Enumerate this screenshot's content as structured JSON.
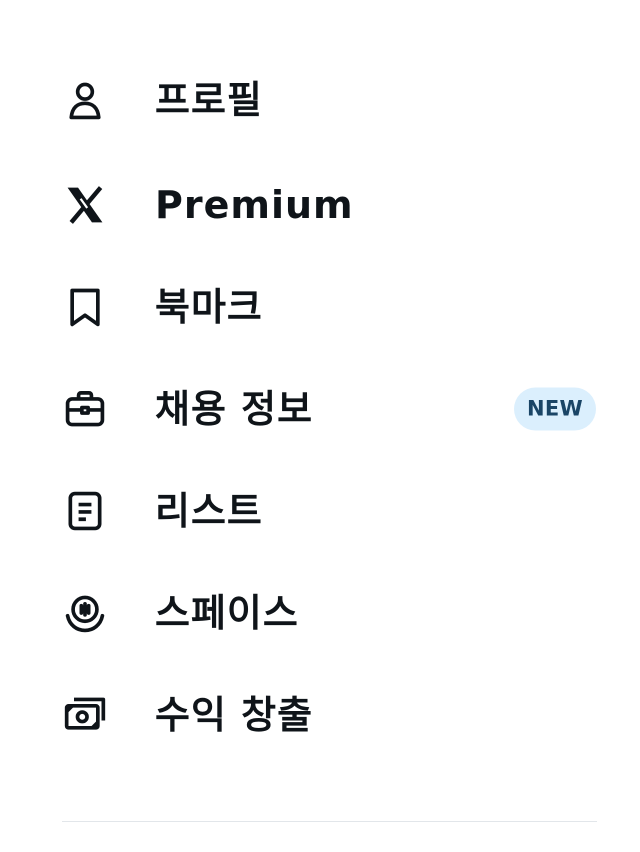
{
  "menu": {
    "items": [
      {
        "label": "프로필",
        "icon": "person-icon"
      },
      {
        "label": "Premium",
        "icon": "x-logo-icon"
      },
      {
        "label": "북마크",
        "icon": "bookmark-icon"
      },
      {
        "label": "채용 정보",
        "icon": "briefcase-icon",
        "badge": "NEW"
      },
      {
        "label": "리스트",
        "icon": "list-icon"
      },
      {
        "label": "스페이스",
        "icon": "spaces-icon"
      },
      {
        "label": "수익 창출",
        "icon": "money-icon"
      }
    ]
  },
  "colors": {
    "text": "#0f1419",
    "badge_bg": "#dbeffd",
    "badge_text": "#1a4566",
    "divider": "#e2e6ea"
  }
}
